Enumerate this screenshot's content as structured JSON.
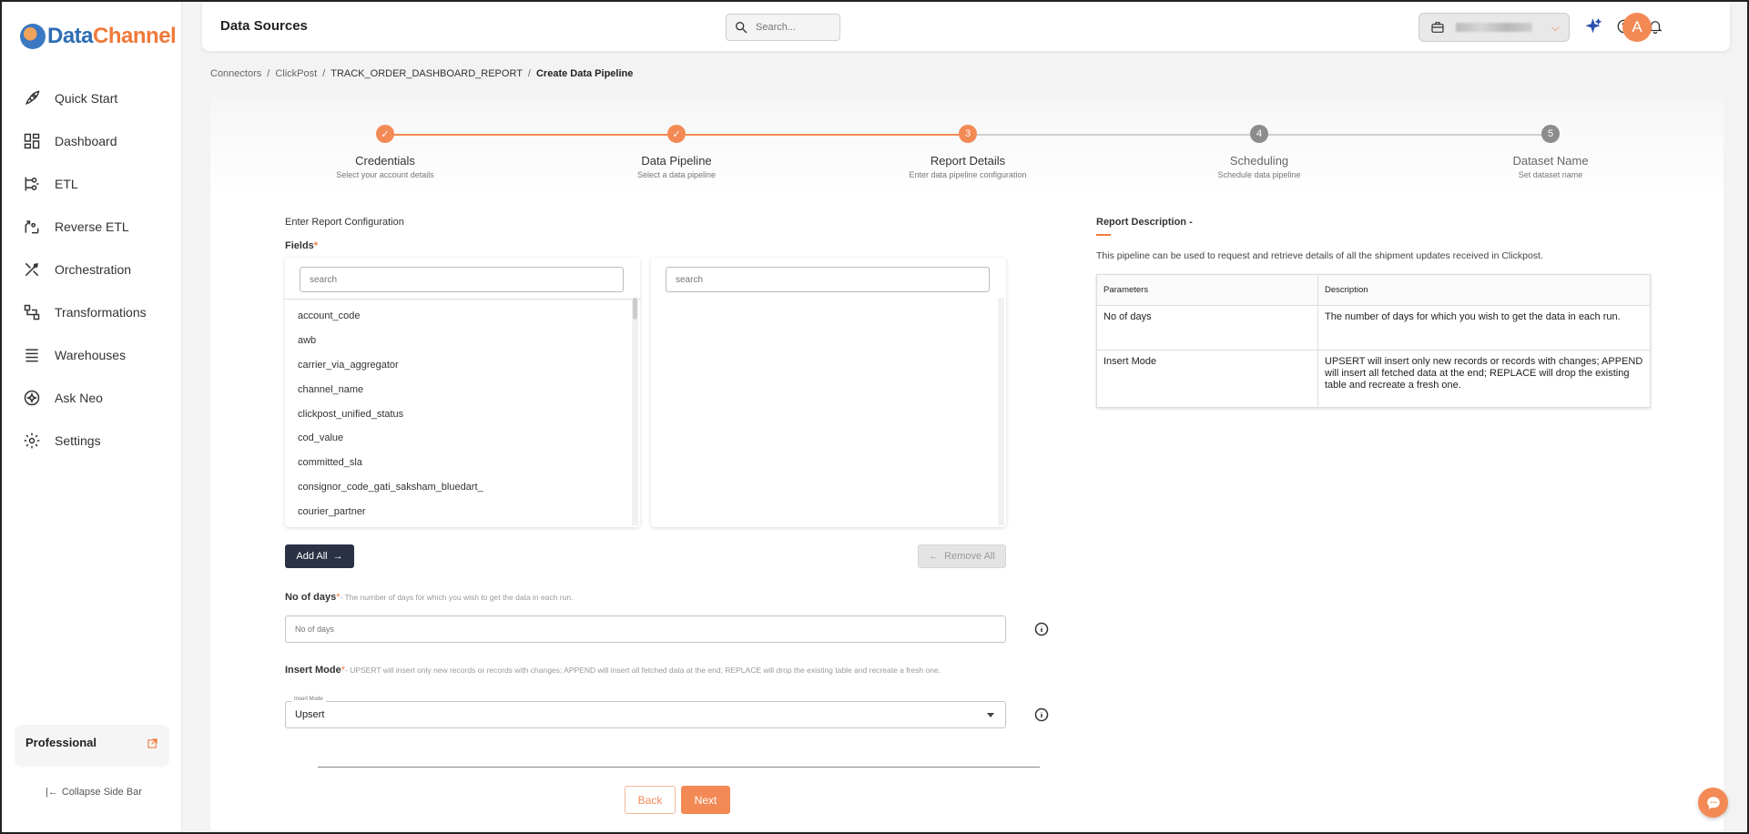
{
  "app": {
    "logo_part1": "Data",
    "logo_part2": "Channel"
  },
  "sidebar": {
    "items": [
      {
        "label": "Quick Start",
        "icon": "rocket-icon"
      },
      {
        "label": "Dashboard",
        "icon": "dashboard-icon"
      },
      {
        "label": "ETL",
        "icon": "etl-icon"
      },
      {
        "label": "Reverse ETL",
        "icon": "reverse-etl-icon"
      },
      {
        "label": "Orchestration",
        "icon": "orchestration-icon"
      },
      {
        "label": "Transformations",
        "icon": "transformations-icon"
      },
      {
        "label": "Warehouses",
        "icon": "warehouses-icon"
      },
      {
        "label": "Ask Neo",
        "icon": "ask-neo-icon"
      },
      {
        "label": "Settings",
        "icon": "gear-icon"
      }
    ],
    "plan": "Professional",
    "collapse_label": "Collapse Side Bar"
  },
  "header": {
    "title": "Data Sources",
    "search_placeholder": "Search..."
  },
  "breadcrumb": {
    "items": [
      "Connectors",
      "ClickPost",
      "TRACK_ORDER_DASHBOARD_REPORT",
      "Create Data Pipeline"
    ]
  },
  "stepper": {
    "steps": [
      {
        "marker": "✓",
        "title": "Credentials",
        "subtitle": "Select your account details",
        "state": "done"
      },
      {
        "marker": "✓",
        "title": "Data Pipeline",
        "subtitle": "Select a data pipeline",
        "state": "done"
      },
      {
        "marker": "3",
        "title": "Report Details",
        "subtitle": "Enter data pipeline configuration",
        "state": "active"
      },
      {
        "marker": "4",
        "title": "Scheduling",
        "subtitle": "Schedule data pipeline",
        "state": "pending"
      },
      {
        "marker": "5",
        "title": "Dataset Name",
        "subtitle": "Set dataset name",
        "state": "pending"
      }
    ]
  },
  "form": {
    "section_title": "Enter Report Configuration",
    "fields_label": "Fields",
    "required_mark": "*",
    "left_search_placeholder": "search",
    "right_search_placeholder": "search",
    "available_fields": [
      "account_code",
      "awb",
      "carrier_via_aggregator",
      "channel_name",
      "clickpost_unified_status",
      "cod_value",
      "committed_sla",
      "consignor_code_gati_saksham_bluedart_",
      "courier_partner"
    ],
    "add_all_label": "Add All",
    "remove_all_label": "Remove All",
    "no_of_days_label": "No of days",
    "no_of_days_hint": "- The number of days for which you wish to get the data in each run.",
    "no_of_days_placeholder": "No of days",
    "insert_mode_label": "Insert Mode",
    "insert_mode_hint": "- UPSERT will insert only new records or records with changes; APPEND will insert all fetched data at the end; REPLACE will drop the existing table and recreate a fresh one.",
    "insert_mode_legend": "Insert Mode",
    "insert_mode_value": "Upsert",
    "back_label": "Back",
    "next_label": "Next"
  },
  "report_description": {
    "title": "Report Description -",
    "text": "This pipeline can be used to request and retrieve details of all the shipment updates received in Clickpost.",
    "table_headers": [
      "Parameters",
      "Description"
    ],
    "rows": [
      {
        "param": "No of days",
        "desc": "The number of days for which you wish to get the data in each run."
      },
      {
        "param": "Insert Mode",
        "desc": "UPSERT will insert only new records or records with changes; APPEND will insert all fetched data at the end; REPLACE will drop the existing table and recreate a fresh one."
      }
    ]
  },
  "colors": {
    "accent": "#f38a55",
    "dark_button": "#2b3245",
    "pending_step": "#8c8c8c"
  }
}
